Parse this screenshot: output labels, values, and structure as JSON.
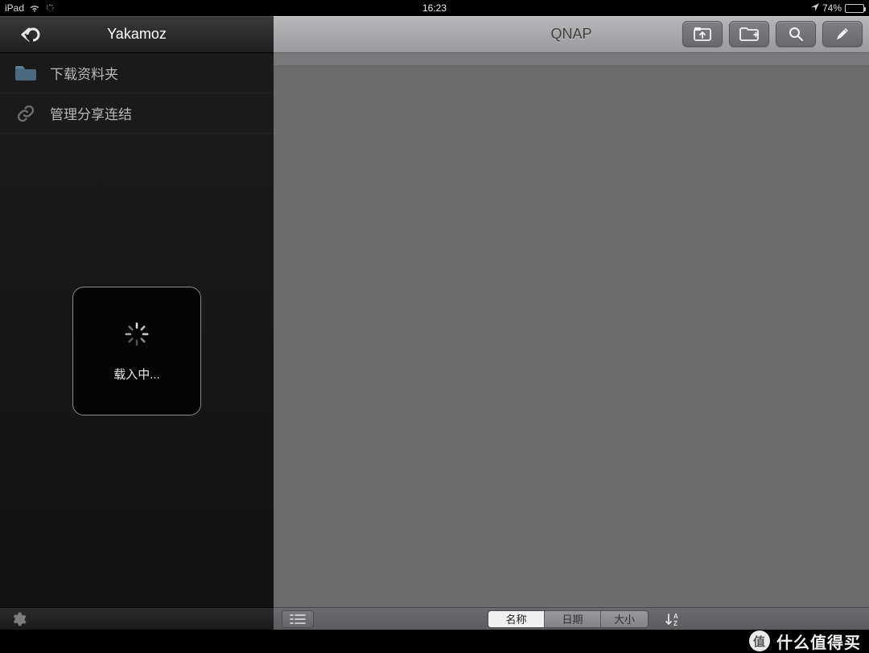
{
  "statusbar": {
    "device": "iPad",
    "time": "16:23",
    "battery_percent": "74%",
    "battery_fill_pct": 74
  },
  "sidebar": {
    "title": "Yakamoz",
    "items": [
      {
        "label": "下载资料夹",
        "icon": "folder-icon"
      },
      {
        "label": "管理分享连结",
        "icon": "link-icon"
      }
    ],
    "loading_label": "载入中..."
  },
  "main": {
    "title": "QNAP",
    "sort_segments": [
      {
        "label": "名称",
        "active": true
      },
      {
        "label": "日期",
        "active": false
      },
      {
        "label": "大小",
        "active": false
      }
    ]
  },
  "watermark": {
    "badge": "值",
    "text": "什么值得买"
  }
}
